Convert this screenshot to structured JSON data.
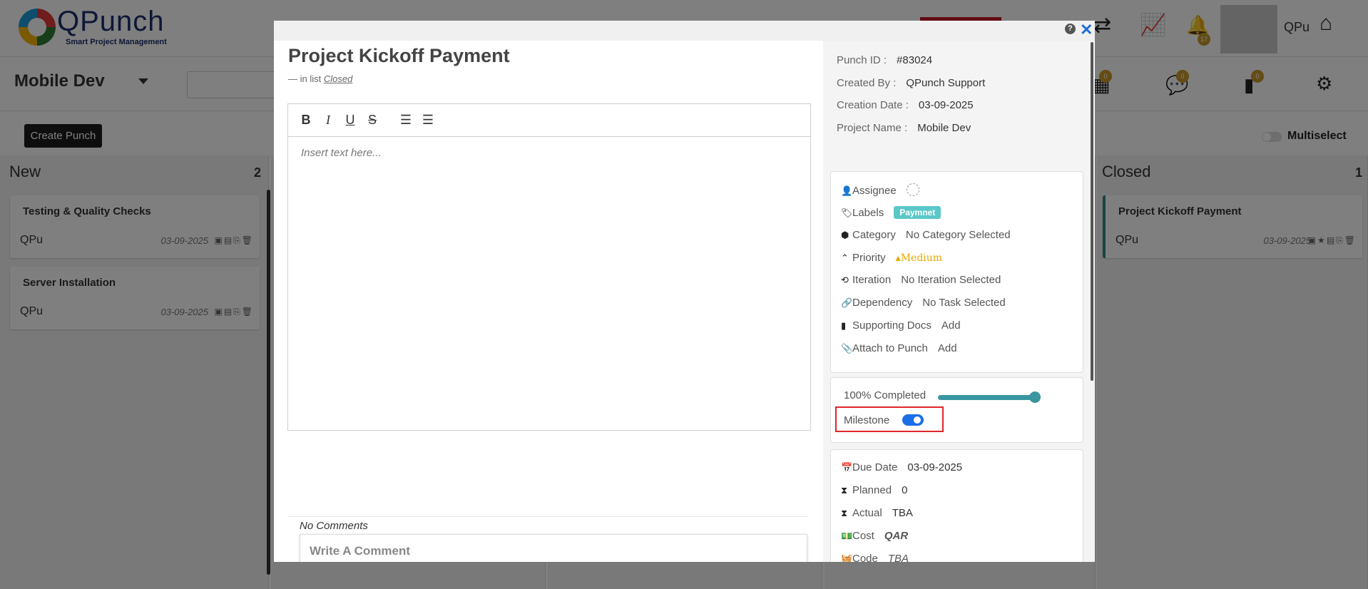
{
  "app": {
    "brand_name": "QPunch",
    "brand_tagline": "Smart Project Management",
    "notification_count": "17",
    "user_short": "QPu",
    "icons": [
      "transfer-icon",
      "chart-icon",
      "bell-icon",
      "home-icon"
    ]
  },
  "project": {
    "name": "Mobile Dev",
    "create_button": "Create Punch",
    "multiselect_label": "Multiselect",
    "badges": [
      "0",
      "0",
      "0"
    ]
  },
  "columns": [
    {
      "title": "New",
      "count": "2",
      "cards": [
        {
          "title": "Testing & Quality Checks",
          "date": "03-09-2025",
          "user": "QPu"
        },
        {
          "title": "Server Installation",
          "date": "03-09-2025",
          "user": "QPu"
        }
      ]
    },
    {
      "title": "Closed",
      "count": "1",
      "cards": [
        {
          "title": "Project Kickoff Payment",
          "date": "03-09-2025",
          "user": "QPu"
        }
      ]
    }
  ],
  "modal": {
    "help_glyph": "?",
    "close_glyph": "✕",
    "title": "Project Kickoff Payment",
    "in_list_prefix": "— in list",
    "list_name": "Closed",
    "toolbar": {
      "bold": "B",
      "italic": "I",
      "underline": "U",
      "strike": "S",
      "ordered": "☰",
      "bullet": "☰"
    },
    "editor_placeholder": "Insert text here...",
    "no_comments": "No Comments",
    "comment_placeholder": "Write A Comment",
    "meta": {
      "punch_id_label": "Punch ID :",
      "punch_id": "#83024",
      "created_by_label": "Created By :",
      "created_by": "QPunch Support",
      "creation_date_label": "Creation Date :",
      "creation_date": "03-09-2025",
      "project_name_label": "Project Name :",
      "project_name": "Mobile Dev"
    },
    "details": {
      "assignee_label": "Assignee",
      "labels_label": "Labels",
      "label_chip": "Paymnet",
      "category_label": "Category",
      "category_value": "No Category Selected",
      "priority_label": "Priority",
      "priority_value": "Medium",
      "iteration_label": "Iteration",
      "iteration_value": "No Iteration Selected",
      "dependency_label": "Dependency",
      "dependency_value": "No Task Selected",
      "supporting_docs_label": "Supporting Docs",
      "supporting_docs_value": "Add",
      "attach_label": "Attach to Punch",
      "attach_value": "Add"
    },
    "progress": {
      "label": "100% Completed",
      "percent": 100,
      "milestone_label": "Milestone",
      "milestone_on": true,
      "accent": "#3a96a0",
      "toggle_color": "#1a6ee8"
    },
    "schedule": {
      "due_date_label": "Due Date",
      "due_date": "03-09-2025",
      "planned_label": "Planned",
      "planned": "0",
      "actual_label": "Actual",
      "actual": "TBA",
      "cost_label": "Cost",
      "cost": "QAR",
      "code_label": "Code",
      "code": "TBA"
    }
  }
}
